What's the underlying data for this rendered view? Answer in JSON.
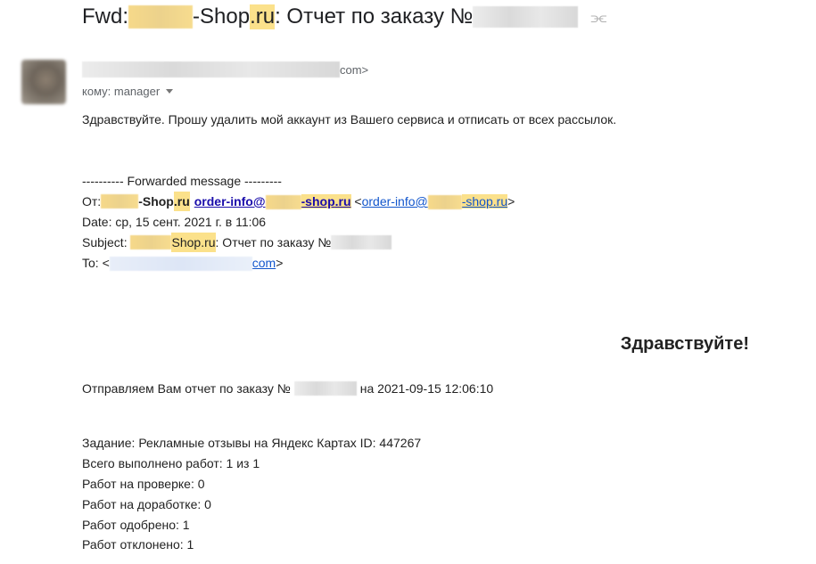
{
  "email": {
    "subject": {
      "prefix": "Fwd: ",
      "shop_suffix": "-Shop",
      "shop_tld": ".ru",
      "rest": ": Отчет по заказу №"
    },
    "sender": {
      "email_suffix": "com>"
    },
    "recipient": {
      "label": "кому: manager"
    },
    "intro": "Здравствуйте. Прошу удалить мой аккаунт из Вашего сервиса и отписать от всех рассылок.",
    "forwarded": {
      "header": "---------- Forwarded message ---------",
      "from_label": "От: ",
      "from_shop_suffix": "-Shop",
      "from_shop_tld": ".ru",
      "from_link_prefix": "order-info@",
      "from_link_shop": "-shop",
      "from_link_tld": ".ru",
      "from_angle_open": " <",
      "from_angle_link_prefix": "order-info@",
      "from_angle_link_shop": "-shop",
      "from_angle_link_tld": ".ru",
      "from_angle_close": ">",
      "date": "Date: ср, 15 сент. 2021 г. в 11:06",
      "subject_label": "Subject: ",
      "subject_shop": "Shop",
      "subject_tld": ".ru",
      "subject_rest": ": Отчет по заказу №",
      "to_label": "To: <",
      "to_suffix": "com",
      "to_close": ">"
    },
    "report": {
      "greeting": "Здравствуйте!",
      "line_prefix": "Отправляем Вам отчет по заказу №",
      "line_suffix": "на 2021-09-15 12:06:10",
      "task": "Задание: Рекламные отзывы на Яндекс Картах ID: 447267",
      "total": "Всего выполнено работ: 1 из 1",
      "review": "Работ на проверке: 0",
      "rework": "Работ на доработке: 0",
      "approved": "Работ одобрено: 1",
      "rejected": "Работ отклонено: 1"
    }
  },
  "icons": {
    "important_marker": "important-marker-icon",
    "recipient_caret": "chevron-down-icon"
  },
  "colors": {
    "highlight": "#fbe18b",
    "link": "#1a0dab"
  }
}
